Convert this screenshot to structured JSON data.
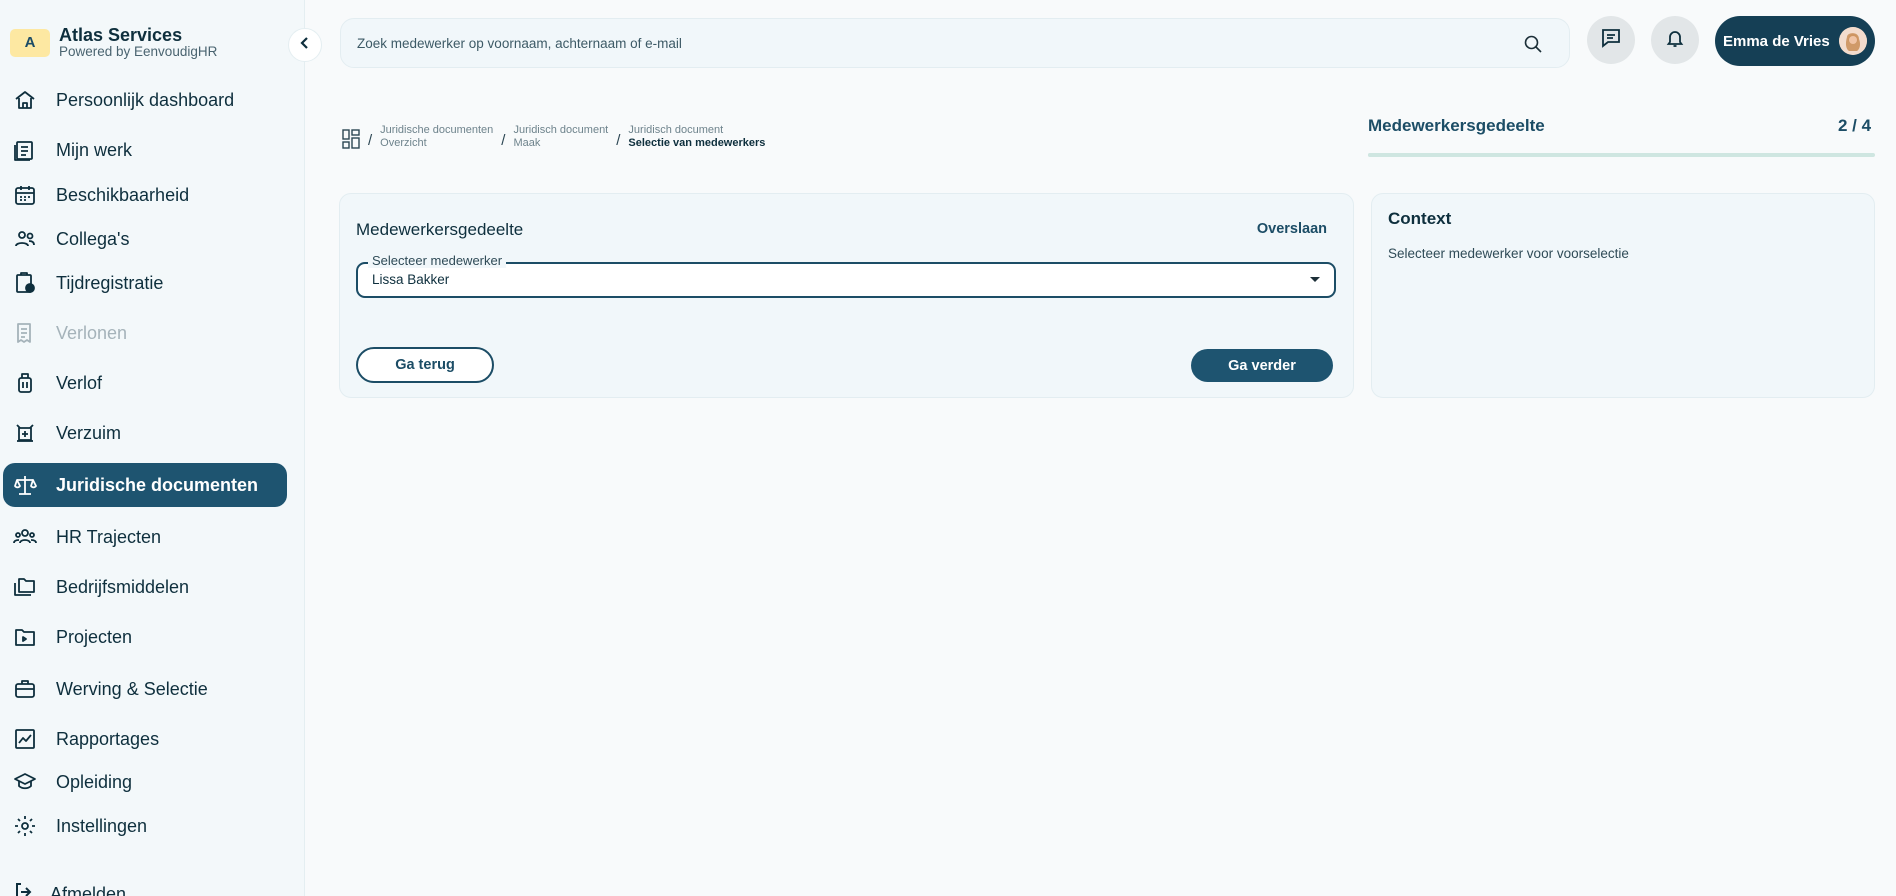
{
  "brand": {
    "name": "Atlas Services",
    "sub": "Powered by EenvoudigHR",
    "logo_letter": "A"
  },
  "sidebar": {
    "items": [
      {
        "label": "Persoonlijk dashboard",
        "icon": "home-icon"
      },
      {
        "label": "Mijn werk",
        "icon": "work-icon"
      },
      {
        "label": "Beschikbaarheid",
        "icon": "calendar-icon"
      },
      {
        "label": "Collega's",
        "icon": "people-icon"
      },
      {
        "label": "Tijdregistratie",
        "icon": "clipboard-clock-icon"
      },
      {
        "label": "Verlonen",
        "icon": "receipt-icon",
        "disabled": true
      },
      {
        "label": "Verlof",
        "icon": "suitcase-icon"
      },
      {
        "label": "Verzuim",
        "icon": "sick-icon"
      },
      {
        "label": "Juridische documenten",
        "icon": "scale-icon",
        "active": true
      },
      {
        "label": "HR Trajecten",
        "icon": "group-icon"
      },
      {
        "label": "Bedrijfsmiddelen",
        "icon": "folders-icon"
      },
      {
        "label": "Projecten",
        "icon": "folder-icon"
      },
      {
        "label": "Werving & Selectie",
        "icon": "briefcase-icon"
      },
      {
        "label": "Rapportages",
        "icon": "chart-icon"
      },
      {
        "label": "Opleiding",
        "icon": "graduation-icon"
      },
      {
        "label": "Instellingen",
        "icon": "gear-icon"
      }
    ],
    "logout": "Afmelden"
  },
  "topbar": {
    "search_placeholder": "Zoek medewerker op voornaam, achternaam of e-mail",
    "user_name": "Emma de Vries"
  },
  "breadcrumb": [
    {
      "title": "Juridische documenten",
      "sub": "Overzicht"
    },
    {
      "title": "Juridisch document",
      "sub": "Maak"
    },
    {
      "title": "Juridisch document",
      "sub": "Selectie van medewerkers"
    }
  ],
  "progress": {
    "title": "Medewerkersgedeelte",
    "count": "2 / 4",
    "fraction": 0.5
  },
  "form": {
    "title": "Medewerkersgedeelte",
    "skip": "Overslaan",
    "select_label": "Selecteer medewerker",
    "select_value": "Lissa Bakker",
    "back": "Ga terug",
    "next": "Ga verder"
  },
  "context": {
    "title": "Context",
    "text": "Selecteer medewerker voor voorselectie"
  },
  "colors": {
    "accent": "#1e5470",
    "sidebar_bg": "#f3f8fa",
    "progress": "#cfe6e1"
  }
}
